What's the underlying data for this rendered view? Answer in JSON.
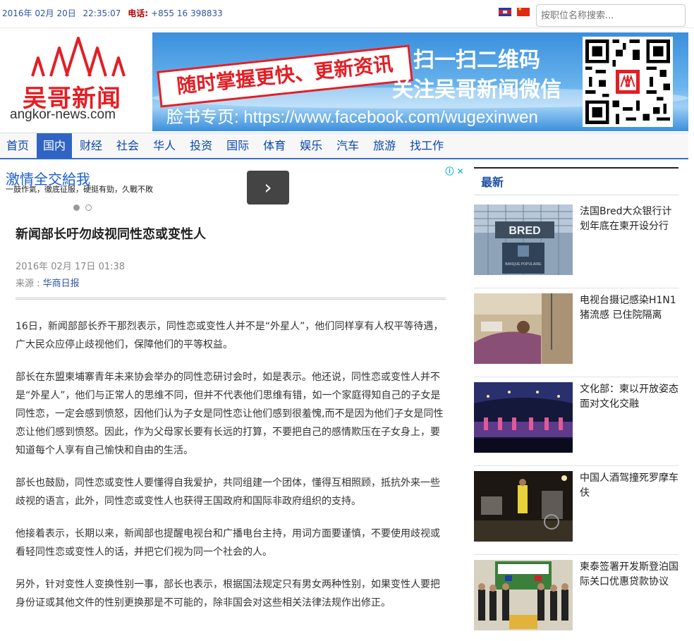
{
  "topbar": {
    "date": "2016年 02月 20日",
    "time": "22:35:07",
    "phone_label": "电话:",
    "phone": "+855 16 398833",
    "search_placeholder": "按职位名称搜索..."
  },
  "logo": {
    "cn": "吴哥新闻",
    "en": "angkor-news.com"
  },
  "banner": {
    "slogan": "随时掌握更快、更新资讯",
    "scan": "扫一扫二维码",
    "follow": "关注吴哥新闻微信",
    "facebook": "脸书专页: https://www.facebook.com/wugexinwen"
  },
  "nav": {
    "items": [
      "首页",
      "国内",
      "财经",
      "社会",
      "华人",
      "投资",
      "国际",
      "体育",
      "娱乐",
      "汽车",
      "旅游",
      "找工作"
    ],
    "active": "国内"
  },
  "ad": {
    "title": "激情全交給我",
    "subtitle": "一鼓作氣，徹底征服，硬挺有勁，久戰不敗",
    "next": "›"
  },
  "article": {
    "title": "新闻部长吁勿歧视同性恋或变性人",
    "date": "2016年 02月 17日 01:38",
    "source_label": "来源 :",
    "source": "华商日报",
    "paragraphs": [
      "16日，新闻部部长乔干那烈表示，同性恋或变性人并不是“外星人”，他们同样享有人权平等待遇，广大民众应停止歧视他们，保障他们的平等权益。",
      "部长在东盟柬埔寨青年未来协会举办的同性恋研讨会时，如是表示。他还说，同性恋或变性人并不是“外星人”，他们与正常人的思维不同，但并不代表他们思维有错，如一个家庭得知自己的子女是同性恋，一定会感到愤怒，因他们认为子女是同性恋让他们感到很羞愧,而不是因为他们子女是同性恋让他们感到愤怒。因此，作为父母家长要有长远的打算，不要把自己的感情欺压在子女身上，要知道每个人享有自己愉快和自由的生活。",
      "部长也鼓励，同性恋或变性人要懂得自我爱护，共同组建一个团体，懂得互相照顾，抵抗外来一些歧视的语言，此外，同性恋或变性人也获得王国政府和国际非政府组织的支持。",
      "他接着表示，长期以来，新闻部也提醒电视台和广播电台主持，用词方面要谨慎，不要使用歧视或看轻同性恋或变性人的话，并把它们视为同一个社会的人。",
      "另外，针对变性人变换性别一事，部长也表示，根据国法规定只有男女两种性别，如果变性人要把身份证或其他文件的性别更换那是不可能的，除非国会对这些相关法律法规作出修正。"
    ]
  },
  "sidebar": {
    "heading": "最新",
    "items": [
      {
        "title": "法国Bred大众银行计划年底在柬开设分行",
        "thumb": "bred-bank-building"
      },
      {
        "title": "电视台摄记感染H1N1猪流感 已住院隔离",
        "thumb": "hospital-patient"
      },
      {
        "title": "文化部：柬以开放姿态面对文化交融",
        "thumb": "stage-performance"
      },
      {
        "title": "中国人酒驾撞死罗摩车伕",
        "thumb": "night-accident-scene"
      },
      {
        "title": "柬泰签署开发斯登泊国际关口优惠贷款协议",
        "thumb": "signing-ceremony"
      }
    ],
    "bred_sign": "BRED",
    "bred_sub": "BANQUE POPULAIRE"
  },
  "colors": {
    "brand_red": "#e31e24",
    "nav_active": "#2f64c4",
    "link_blue": "#0a47a9"
  }
}
